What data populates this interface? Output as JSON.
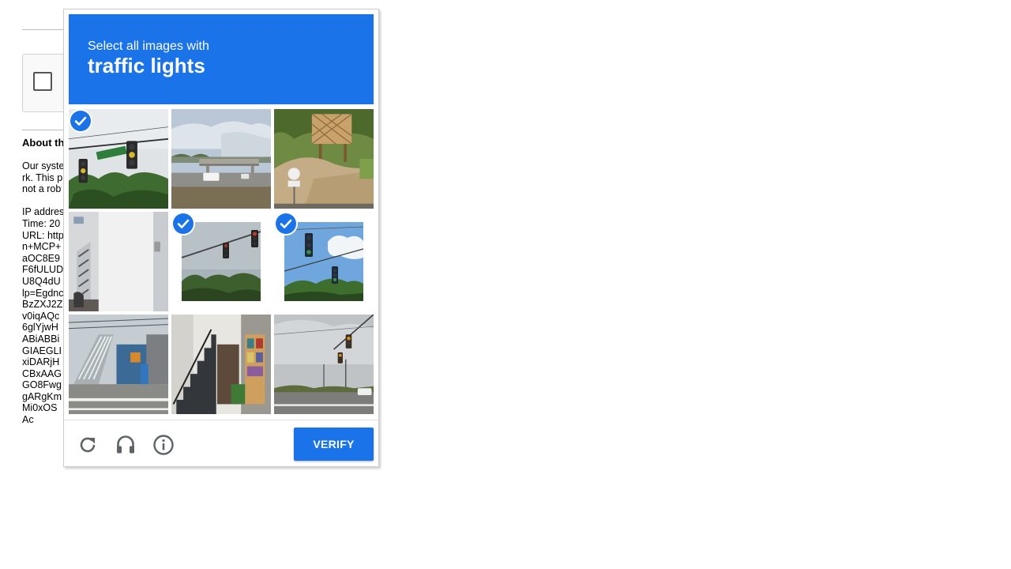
{
  "background": {
    "about_title": "About th",
    "paragraph_lines": [
      "Our syste",
      "rk. This p",
      "not a rob"
    ],
    "detail_lines": [
      "IP addres",
      "Time: 20",
      "URL: http",
      "n+MCP+",
      "aOC8E9",
      "F6fULUD",
      "U8Q4dU",
      "lp=Egdnc",
      "BzZXJ2Z",
      "v0iqAQc",
      "6glYjwH",
      "ABiABBi",
      "GIAEGLI",
      "xiDARjH",
      "CBxAAG",
      "GO8Fwg",
      "gARgKm",
      "Mi0xOS",
      "Ac"
    ]
  },
  "challenge": {
    "instruction_line1": "Select all images with",
    "instruction_target": "traffic lights",
    "header_color": "#1a73e8",
    "tiles": [
      {
        "index": 0,
        "scene": "traffic-light-street-sign",
        "selected": true
      },
      {
        "index": 1,
        "scene": "highway-overpass",
        "selected": false
      },
      {
        "index": 2,
        "scene": "hillside-house-sign",
        "selected": false
      },
      {
        "index": 3,
        "scene": "building-stairway",
        "selected": false
      },
      {
        "index": 4,
        "scene": "traffic-lights-trees",
        "selected": true
      },
      {
        "index": 5,
        "scene": "traffic-lights-blue-sky",
        "selected": true
      },
      {
        "index": 6,
        "scene": "outdoor-staircase",
        "selected": false
      },
      {
        "index": 7,
        "scene": "indoor-staircase",
        "selected": false
      },
      {
        "index": 8,
        "scene": "intersection-traffic-light",
        "selected": false
      }
    ],
    "footer": {
      "reload_icon": "reload-icon",
      "audio_icon": "headphones-icon",
      "info_icon": "info-icon",
      "verify_label": "VERIFY"
    }
  }
}
